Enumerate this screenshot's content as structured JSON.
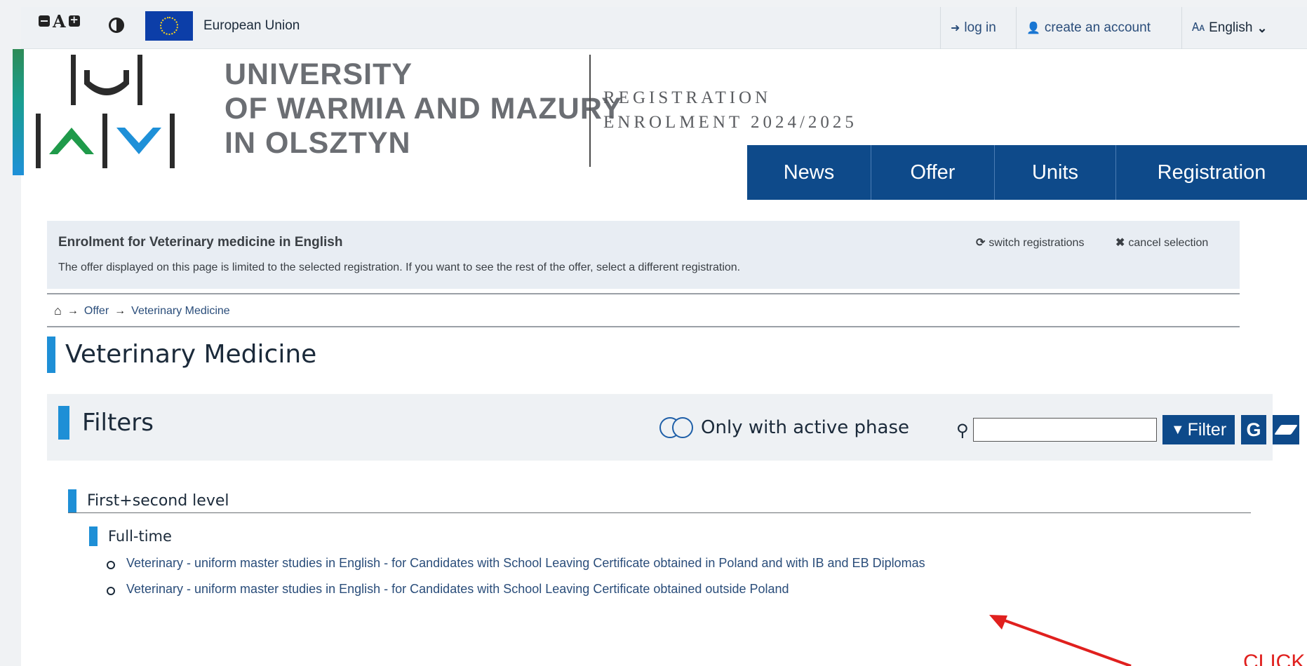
{
  "top_bar": {
    "accessibility": {
      "decrease_icon": "minus-square-icon",
      "font_letter": "A",
      "increase_icon": "plus-square-icon",
      "contrast_icon": "contrast-icon"
    },
    "eu_label": "European Union",
    "login_label": "log in",
    "create_account_label": "create an account",
    "language_label": "English"
  },
  "header": {
    "university_lines": [
      "UNIVERSITY",
      "OF WARMIA AND MAZURY",
      "IN OLSZTYN"
    ],
    "registration_lines": [
      "REGISTRATION",
      "ENROLMENT 2024/2025"
    ]
  },
  "nav": {
    "items": [
      "News",
      "Offer",
      "Units",
      "Registration"
    ]
  },
  "selection": {
    "title": "Enrolment for Veterinary medicine in English",
    "description": "The offer displayed on this page is limited to the selected registration. If you want to see the rest of the offer, select a different registration.",
    "switch_label": "switch registrations",
    "cancel_label": "cancel selection"
  },
  "breadcrumb": {
    "items": [
      "Offer",
      "Veterinary Medicine"
    ]
  },
  "page_title": "Veterinary Medicine",
  "filters": {
    "title": "Filters",
    "toggle_label": "Only with active phase",
    "search_value": "",
    "filter_button": "Filter",
    "g_button": "G"
  },
  "tree": {
    "level": "First+second level",
    "mode": "Full-time",
    "offers": [
      "Veterinary - uniform master studies in English - for Candidates with School Leaving Certificate obtained in Poland and with IB and EB Diplomas",
      "Veterinary - uniform master studies in English - for Candidates with School Leaving Certificate obtained outside Poland"
    ]
  },
  "annotation": {
    "text": "CLICK",
    "color": "#e0201e"
  },
  "colors": {
    "primary_blue": "#0e4a8a",
    "accent_blue": "#1e8fd6",
    "link": "#2a4d7a"
  }
}
